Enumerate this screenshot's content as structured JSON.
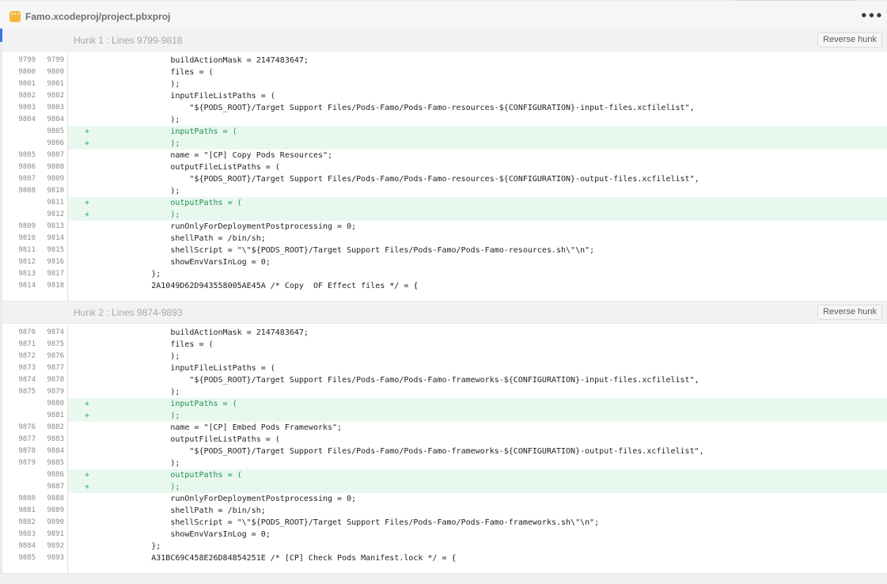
{
  "file": {
    "icon": "xcode-project-file-icon",
    "icon_glyph": "···",
    "name": "Famo.xcodeproj/project.pbxproj",
    "more_glyph": "•••"
  },
  "hunks": [
    {
      "title": "Hunk 1 : Lines 9799-9818",
      "reverse_label": "Reverse hunk",
      "lines": [
        {
          "old": "9799",
          "new": "9799",
          "type": "context",
          "code": "                buildActionMask = 2147483647;"
        },
        {
          "old": "9800",
          "new": "9800",
          "type": "context",
          "code": "                files = ("
        },
        {
          "old": "9801",
          "new": "9801",
          "type": "context",
          "code": "                );"
        },
        {
          "old": "9802",
          "new": "9802",
          "type": "context",
          "code": "                inputFileListPaths = ("
        },
        {
          "old": "9803",
          "new": "9803",
          "type": "context",
          "code": "                    \"${PODS_ROOT}/Target Support Files/Pods-Famo/Pods-Famo-resources-${CONFIGURATION}-input-files.xcfilelist\","
        },
        {
          "old": "9804",
          "new": "9804",
          "type": "context",
          "code": "                );"
        },
        {
          "old": "",
          "new": "9805",
          "type": "added",
          "code": "                inputPaths = ("
        },
        {
          "old": "",
          "new": "9806",
          "type": "added",
          "code": "                );"
        },
        {
          "old": "9805",
          "new": "9807",
          "type": "context",
          "code": "                name = \"[CP] Copy Pods Resources\";"
        },
        {
          "old": "9806",
          "new": "9808",
          "type": "context",
          "code": "                outputFileListPaths = ("
        },
        {
          "old": "9807",
          "new": "9809",
          "type": "context",
          "code": "                    \"${PODS_ROOT}/Target Support Files/Pods-Famo/Pods-Famo-resources-${CONFIGURATION}-output-files.xcfilelist\","
        },
        {
          "old": "9808",
          "new": "9810",
          "type": "context",
          "code": "                );"
        },
        {
          "old": "",
          "new": "9811",
          "type": "added",
          "code": "                outputPaths = ("
        },
        {
          "old": "",
          "new": "9812",
          "type": "added",
          "code": "                );"
        },
        {
          "old": "9809",
          "new": "9813",
          "type": "context",
          "code": "                runOnlyForDeploymentPostprocessing = 0;"
        },
        {
          "old": "9810",
          "new": "9814",
          "type": "context",
          "code": "                shellPath = /bin/sh;"
        },
        {
          "old": "9811",
          "new": "9815",
          "type": "context",
          "code": "                shellScript = \"\\\"${PODS_ROOT}/Target Support Files/Pods-Famo/Pods-Famo-resources.sh\\\"\\n\";"
        },
        {
          "old": "9812",
          "new": "9816",
          "type": "context",
          "code": "                showEnvVarsInLog = 0;"
        },
        {
          "old": "9813",
          "new": "9817",
          "type": "context",
          "code": "            };"
        },
        {
          "old": "9814",
          "new": "9818",
          "type": "context",
          "code": "            2A1049D62D943558005AE45A /* Copy  OF Effect files */ = {"
        }
      ]
    },
    {
      "title": "Hunk 2 : Lines 9874-9893",
      "reverse_label": "Reverse hunk",
      "lines": [
        {
          "old": "9870",
          "new": "9874",
          "type": "context",
          "code": "                buildActionMask = 2147483647;"
        },
        {
          "old": "9871",
          "new": "9875",
          "type": "context",
          "code": "                files = ("
        },
        {
          "old": "9872",
          "new": "9876",
          "type": "context",
          "code": "                );"
        },
        {
          "old": "9873",
          "new": "9877",
          "type": "context",
          "code": "                inputFileListPaths = ("
        },
        {
          "old": "9874",
          "new": "9878",
          "type": "context",
          "code": "                    \"${PODS_ROOT}/Target Support Files/Pods-Famo/Pods-Famo-frameworks-${CONFIGURATION}-input-files.xcfilelist\","
        },
        {
          "old": "9875",
          "new": "9879",
          "type": "context",
          "code": "                );"
        },
        {
          "old": "",
          "new": "9880",
          "type": "added",
          "code": "                inputPaths = ("
        },
        {
          "old": "",
          "new": "9881",
          "type": "added",
          "code": "                );"
        },
        {
          "old": "9876",
          "new": "9882",
          "type": "context",
          "code": "                name = \"[CP] Embed Pods Frameworks\";"
        },
        {
          "old": "9877",
          "new": "9883",
          "type": "context",
          "code": "                outputFileListPaths = ("
        },
        {
          "old": "9878",
          "new": "9884",
          "type": "context",
          "code": "                    \"${PODS_ROOT}/Target Support Files/Pods-Famo/Pods-Famo-frameworks-${CONFIGURATION}-output-files.xcfilelist\","
        },
        {
          "old": "9879",
          "new": "9885",
          "type": "context",
          "code": "                );"
        },
        {
          "old": "",
          "new": "9886",
          "type": "added",
          "code": "                outputPaths = ("
        },
        {
          "old": "",
          "new": "9887",
          "type": "added",
          "code": "                );"
        },
        {
          "old": "9880",
          "new": "9888",
          "type": "context",
          "code": "                runOnlyForDeploymentPostprocessing = 0;"
        },
        {
          "old": "9881",
          "new": "9889",
          "type": "context",
          "code": "                shellPath = /bin/sh;"
        },
        {
          "old": "9882",
          "new": "9890",
          "type": "context",
          "code": "                shellScript = \"\\\"${PODS_ROOT}/Target Support Files/Pods-Famo/Pods-Famo-frameworks.sh\\\"\\n\";"
        },
        {
          "old": "9883",
          "new": "9891",
          "type": "context",
          "code": "                showEnvVarsInLog = 0;"
        },
        {
          "old": "9884",
          "new": "9892",
          "type": "context",
          "code": "            };"
        },
        {
          "old": "9885",
          "new": "9893",
          "type": "context",
          "code": "            A31BC69C458E26D84854251E /* [CP] Check Pods Manifest.lock */ = {"
        }
      ]
    }
  ],
  "colors": {
    "added_bg": "#e9f8ef",
    "added_text": "#1d8f50",
    "accent": "#3a78e6",
    "file_icon": "#f4b73b"
  }
}
